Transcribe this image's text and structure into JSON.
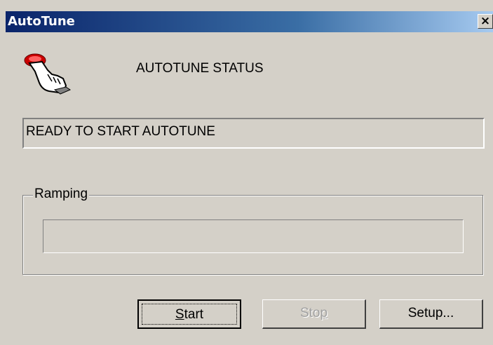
{
  "window": {
    "title": "AutoTune",
    "close_glyph": "✕"
  },
  "icon": {
    "name": "hand-press-icon",
    "color": "#cc0000"
  },
  "status": {
    "heading": "AUTOTUNE STATUS",
    "message": "READY TO START AUTOTUNE"
  },
  "ramping": {
    "label": "Ramping",
    "progress": 0
  },
  "buttons": {
    "start": {
      "label": "Start",
      "underline_index": 0,
      "enabled": true,
      "default": true
    },
    "stop": {
      "label": "Stop",
      "underline_index": 3,
      "enabled": false
    },
    "setup": {
      "label": "Setup...",
      "enabled": true
    }
  },
  "colors": {
    "face": "#d4d0c8",
    "title_active": "#0a246a",
    "disabled_text": "#a0a0a0"
  }
}
